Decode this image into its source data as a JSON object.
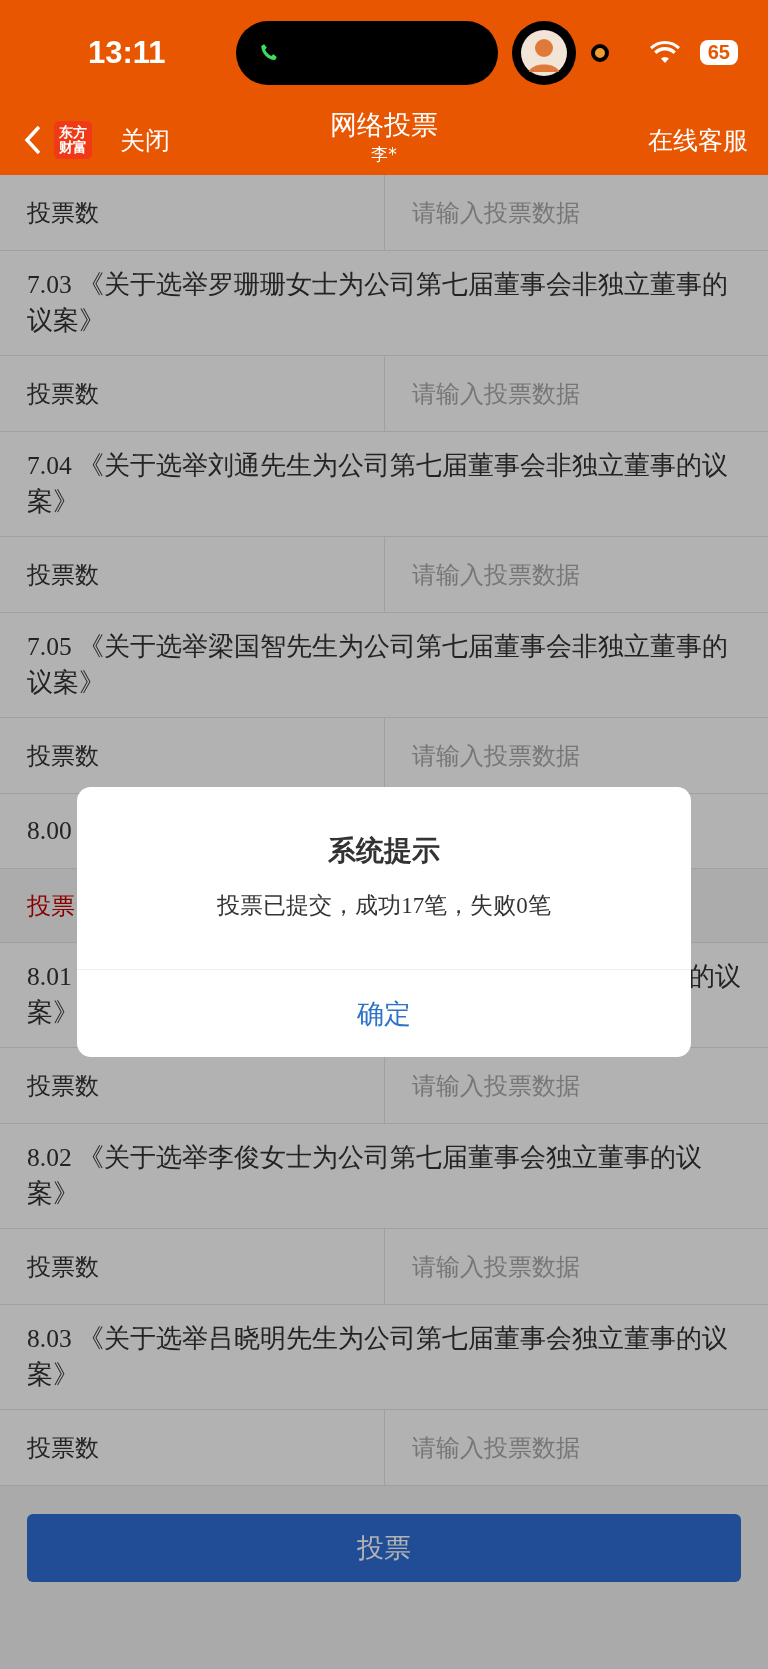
{
  "status_bar": {
    "time": "13:11",
    "battery": "65"
  },
  "header": {
    "back": "关闭",
    "logo_lines": [
      "东方",
      "财富"
    ],
    "title": "网络投票",
    "subtitle": "李*",
    "action": "在线客服"
  },
  "rows": [
    {
      "kind": "input",
      "label": "投票数",
      "placeholder": "请输入投票数据"
    },
    {
      "kind": "title",
      "text": "7.03 《关于选举罗珊珊女士为公司第七届董事会非独立董事的议案》"
    },
    {
      "kind": "input",
      "label": "投票数",
      "placeholder": "请输入投票数据"
    },
    {
      "kind": "title",
      "text": "7.04 《关于选举刘通先生为公司第七届董事会非独立董事的议案》"
    },
    {
      "kind": "input",
      "label": "投票数",
      "placeholder": "请输入投票数据"
    },
    {
      "kind": "title",
      "text": "7.05 《关于选举梁国智先生为公司第七届董事会非独立董事的议案》"
    },
    {
      "kind": "input",
      "label": "投票数",
      "placeholder": "请输入投票数据"
    },
    {
      "kind": "title",
      "text": "8.00"
    },
    {
      "kind": "notice",
      "text": "投票"
    },
    {
      "kind": "partial",
      "start": "8.01",
      "end": "的议",
      "second": "案》"
    },
    {
      "kind": "input",
      "label": "投票数",
      "placeholder": "请输入投票数据"
    },
    {
      "kind": "title",
      "text": "8.02 《关于选举李俊女士为公司第七届董事会独立董事的议案》"
    },
    {
      "kind": "input",
      "label": "投票数",
      "placeholder": "请输入投票数据"
    },
    {
      "kind": "title",
      "text": "8.03 《关于选举吕晓明先生为公司第七届董事会独立董事的议案》"
    },
    {
      "kind": "input",
      "label": "投票数",
      "placeholder": "请输入投票数据"
    }
  ],
  "submit": "投票",
  "dialog": {
    "title": "系统提示",
    "message": "投票已提交，成功17笔，失败0笔",
    "confirm": "确定"
  }
}
